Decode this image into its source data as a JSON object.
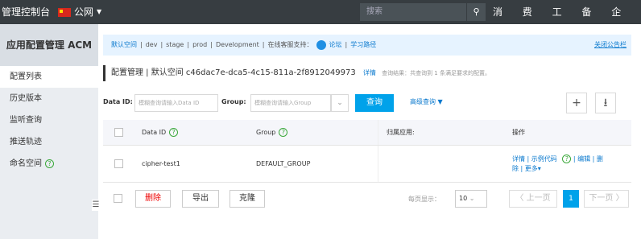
{
  "topbar": {
    "brand": "管理控制台",
    "region": "公网",
    "search_placeholder": "搜索",
    "nav": [
      "消息",
      "费用",
      "工单",
      "备案",
      "企业"
    ]
  },
  "sidebar": {
    "title": "应用配置管理 ACM",
    "items": [
      {
        "label": "配置列表"
      },
      {
        "label": "历史版本"
      },
      {
        "label": "监听查询"
      },
      {
        "label": "推送轨迹"
      },
      {
        "label": "命名空间"
      }
    ]
  },
  "notice": {
    "namespaces": [
      "默认空间",
      "dev",
      "stage",
      "prod",
      "Development"
    ],
    "support_label": "在线客服支持：",
    "forum": "论坛",
    "learn": "学习路径",
    "close": "关闭公告栏"
  },
  "header": {
    "title": "配置管理 | 默认空间 c46dac7e-dca5-4c15-811a-2f8912049973",
    "detail": "详情",
    "result": "查询结果：共查询到 1 条满足要求的配置。"
  },
  "filter": {
    "dataid_label": "Data ID:",
    "dataid_placeholder": "模糊查询请输入Data ID",
    "group_label": "Group:",
    "group_placeholder": "模糊查询请输入Group",
    "query": "查询",
    "advanced": "高级查询 ▼",
    "add_symbol": "+",
    "download_symbol": "⭳"
  },
  "table": {
    "headers": [
      "Data ID",
      "Group",
      "归属应用:",
      "操作"
    ],
    "rows": [
      {
        "data_id": "cipher-test1",
        "group": "DEFAULT_GROUP",
        "app": "",
        "ops_line1": "详情 | 示例代码",
        "ops_line1b": "| 编辑 | 删",
        "ops_line2": "除 | 更多▾"
      }
    ]
  },
  "footer": {
    "delete": "删除",
    "export": "导出",
    "clone": "克隆",
    "per_page_label": "每页显示：",
    "per_page_value": "10",
    "prev": "〈 上一页",
    "current_page": "1",
    "next": "下一页 〉"
  }
}
